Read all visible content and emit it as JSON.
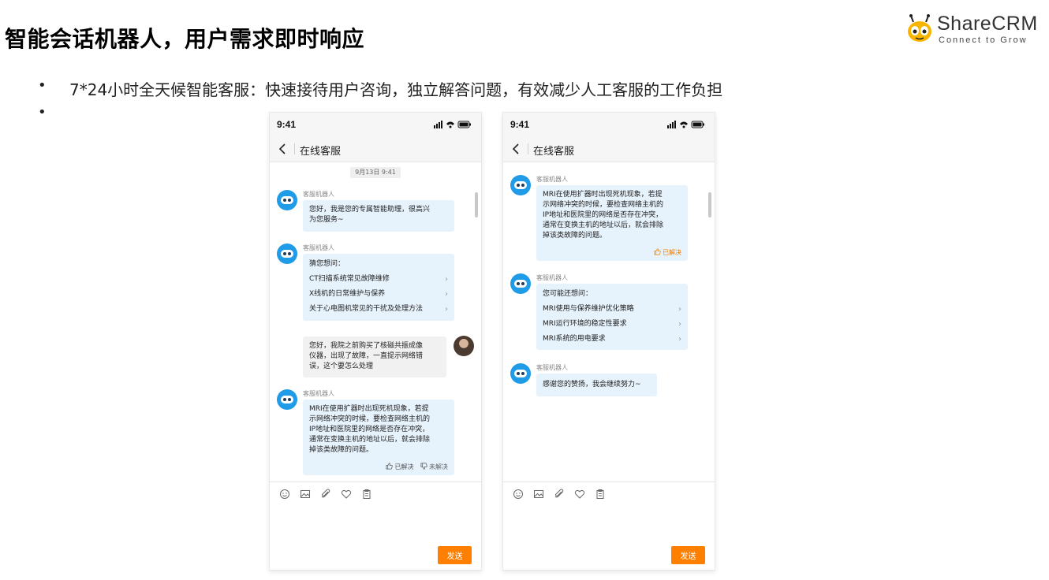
{
  "slide": {
    "title": "智能会话机器人，用户需求即时响应",
    "bullets": [
      "7*24小时全天候智能客服：快速接待用户咨询，独立解答问题，有效减少人工客服的工作负担",
      ""
    ],
    "bullet_marker": "•"
  },
  "logo": {
    "name": "ShareCRM",
    "tagline": "Connect to Grow",
    "brand_color": "#f7b500"
  },
  "phone_left": {
    "status_time": "9:41",
    "nav_title": "在线客服",
    "date_chip": "9月13日 9:41",
    "msg1": {
      "sender": "客服机器人",
      "lines": [
        "您好，我是您的专属智能助理，很高兴",
        "为您服务~"
      ]
    },
    "msg2": {
      "sender": "客服机器人",
      "intro": "猜您想问：",
      "suggestions": [
        "CT扫描系统常见故障维修",
        "X线机的日常维护与保养",
        "关于心电图机常见的干扰及处理方法"
      ]
    },
    "msg3": {
      "lines": [
        "您好，我院之前购买了核磁共振成像",
        "仪器，出现了故障，一直提示网络错",
        "误，这个要怎么处理"
      ]
    },
    "msg4": {
      "sender": "客服机器人",
      "lines": [
        "MRI在使用扩器时出现死机现象，若提",
        "示网络冲突的时候，要检查网络主机的",
        "IP地址和医院里的网络是否存在冲突，",
        "通常在变换主机的地址以后，就会排除",
        "掉该类故障的问题。"
      ],
      "solved": "已解决",
      "unsolved": "未解决"
    },
    "send": "发送"
  },
  "phone_right": {
    "status_time": "9:41",
    "nav_title": "在线客服",
    "msg1": {
      "sender": "客服机器人",
      "lines": [
        "MRI在使用扩器时出现死机现象，若提",
        "示网络冲突的时候，要检查网络主机的",
        "IP地址和医院里的网络是否存在冲突，",
        "通常在变换主机的地址以后，就会排除",
        "掉该类故障的问题。"
      ],
      "solved": "已解决"
    },
    "msg2": {
      "sender": "客服机器人",
      "intro": "您可能还想问：",
      "suggestions": [
        "MRI使用与保养维护优化策略",
        "MRI运行环境的稳定性要求",
        "MRI系统的用电要求"
      ]
    },
    "msg3": {
      "sender": "客服机器人",
      "lines": [
        "感谢您的赞扬，我会继续努力~"
      ]
    },
    "send": "发送"
  },
  "colors": {
    "accent": "#ff8000",
    "bot_bubble": "#e6f2fc",
    "user_bubble": "#f1f1f1",
    "bot_avatar": "#1f9be8"
  },
  "icons": [
    "back-arrow-icon",
    "signal-icon",
    "wifi-icon",
    "battery-icon",
    "emoji-icon",
    "image-icon",
    "attachment-icon",
    "heart-icon",
    "clipboard-icon",
    "thumb-up-icon",
    "thumb-down-icon",
    "chevron-right-icon"
  ]
}
